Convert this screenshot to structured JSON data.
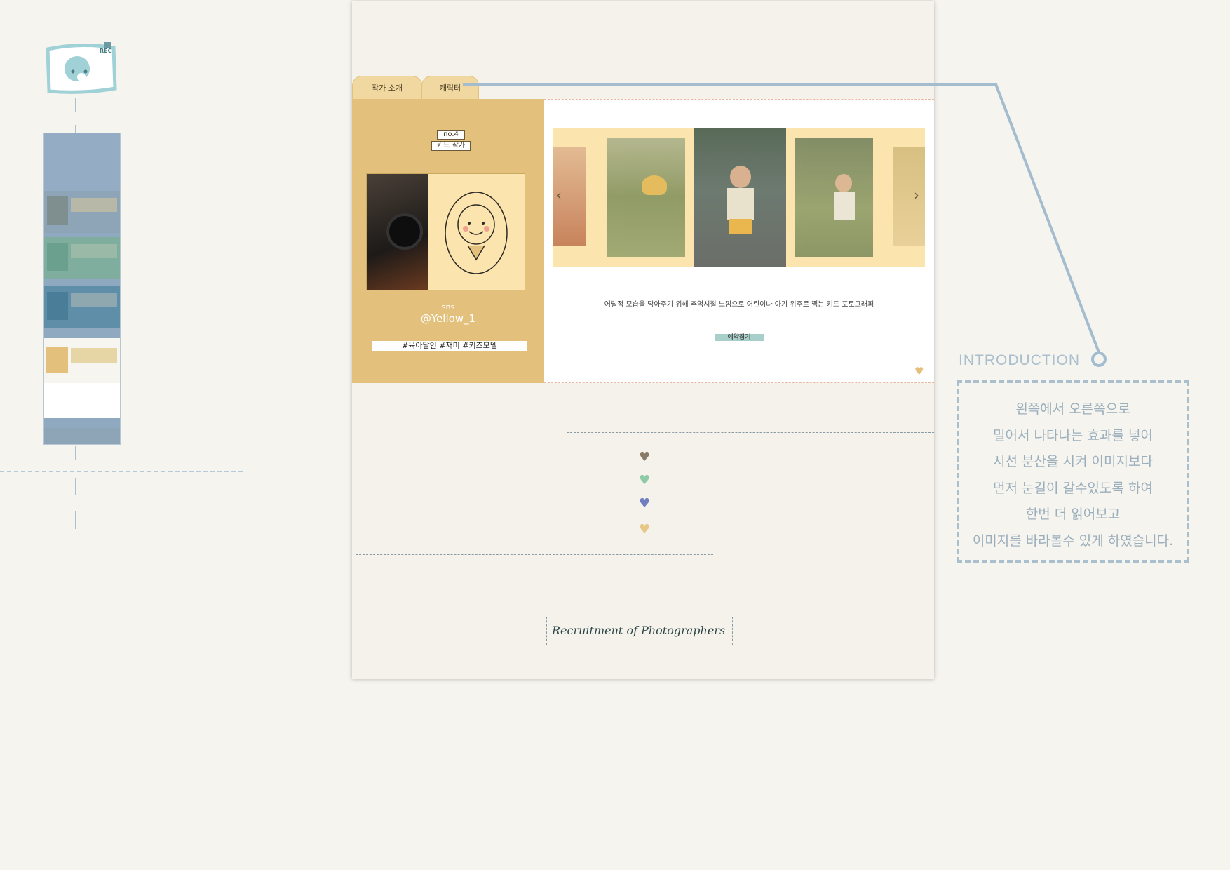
{
  "tabs": [
    {
      "label": "작가 소개"
    },
    {
      "label": "캐릭터"
    }
  ],
  "profile": {
    "number": "no.4",
    "role": "키드 작가",
    "sns_label": "sns",
    "handle": "@Yellow_1",
    "hashtags": "#육아달인 #재미 #키즈모델"
  },
  "gallery": {
    "description": "어릴적 모습을 담아주기 위해 추억시절 느낌으로 어린이나 아기 위주로 찍는 키드 포토그래퍼",
    "reserve_button": "예약잡기",
    "prev_glyph": "‹",
    "next_glyph": "›",
    "heart_glyph": "♥"
  },
  "hearts": [
    {
      "glyph": "♥",
      "color": "#8a7b68"
    },
    {
      "glyph": "♥",
      "color": "#8fc9a6"
    },
    {
      "glyph": "♥",
      "color": "#6f7fc0"
    },
    {
      "glyph": "♥",
      "color": "#e6c786"
    }
  ],
  "footer": {
    "recruit_title": "Recruitment of Photographers"
  },
  "intro": {
    "title": "INTRODUCTION",
    "lines": [
      "왼쪽에서 오른쪽으로",
      "밀어서 나타나는 효과를 넣어",
      "시선 분산을 시켜 이미지보다",
      "먼저 눈길이 갈수있도록 하여",
      "한번 더 읽어보고",
      "이미지를 바라볼수 있게 하였습니다."
    ]
  },
  "logo": {
    "badge": "REC"
  },
  "colors": {
    "background": "#f6f4ef",
    "profile_bg": "#e3c07c",
    "gallery_bg": "#fbe4ad",
    "accent_line": "#a3bdcf",
    "button_bar": "#a9cfcb"
  }
}
